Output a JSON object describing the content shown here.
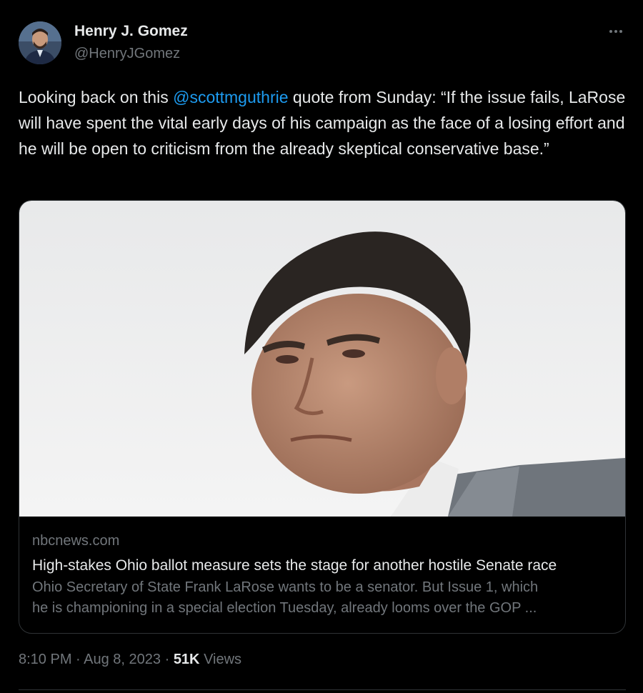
{
  "author": {
    "name": "Henry J. Gomez",
    "handle": "@HenryJGomez"
  },
  "tweet": {
    "text_before": "Looking back on this ",
    "mention": "@scottmguthrie",
    "text_after": " quote from Sunday: “If the issue fails, LaRose will have spent the vital early days of his campaign as the face of a losing effort and he will be open to criticism from the already skeptical conservative base.”"
  },
  "card": {
    "domain": "nbcnews.com",
    "headline": "High-stakes Ohio ballot measure sets the stage for another hostile Senate race",
    "description_line1": "Ohio Secretary of State Frank LaRose wants to be a senator. But Issue 1, which",
    "description_line2": "he is championing in a special election Tuesday, already looms over the GOP ..."
  },
  "meta": {
    "time": "8:10 PM",
    "sep1": " · ",
    "date": "Aug 8, 2023",
    "sep2": " · ",
    "views_count": "51K",
    "views_label": " Views"
  },
  "icons": {
    "more": "more-options-icon"
  }
}
